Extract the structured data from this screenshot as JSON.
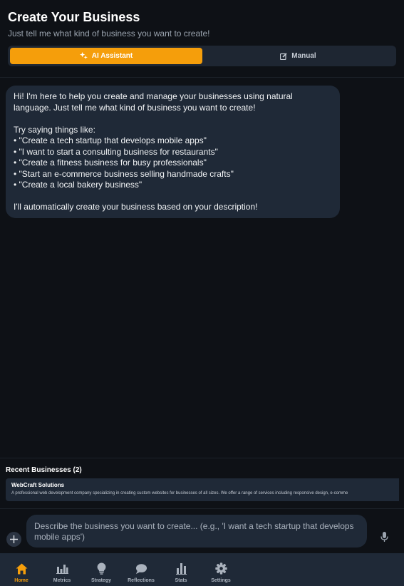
{
  "header": {
    "title": "Create Your Business",
    "subtitle": "Just tell me what kind of business you want to create!",
    "modes": [
      {
        "label": "AI Assistant",
        "icon": "sparkle-icon",
        "active": true
      },
      {
        "label": "Manual",
        "icon": "edit-icon",
        "active": false
      }
    ]
  },
  "chat": {
    "messages": [
      {
        "role": "assistant",
        "lines": [
          "Hi! I'm here to help you create and manage your businesses using natural language. Just tell me what kind of business you want to create!",
          "",
          "Try saying things like:",
          "• \"Create a tech startup that develops mobile apps\"",
          "• \"I want to start a consulting business for restaurants\"",
          "• \"Create a fitness business for busy professionals\"",
          "• \"Start an e-commerce business selling handmade crafts\"",
          "• \"Create a local bakery business\"",
          "",
          "I'll automatically create your business based on your description!"
        ]
      }
    ]
  },
  "recent": {
    "title": "Recent Businesses (2)",
    "items": [
      {
        "name": "WebCraft Solutions",
        "description": "A professional web development company specializing in creating custom websites for businesses of all sizes. We offer a range of services including responsive design, e-comme"
      }
    ]
  },
  "composer": {
    "placeholder": "Describe the business you want to create... (e.g., 'I want a tech startup that develops mobile apps')",
    "add_icon": "plus-icon",
    "mic_icon": "microphone-icon"
  },
  "nav": {
    "items": [
      {
        "label": "Home",
        "icon": "home-icon",
        "active": true
      },
      {
        "label": "Metrics",
        "icon": "bar-chart-icon",
        "active": false
      },
      {
        "label": "Strategy",
        "icon": "lightbulb-icon",
        "active": false
      },
      {
        "label": "Reflections",
        "icon": "chat-bubbles-icon",
        "active": false
      },
      {
        "label": "Stats",
        "icon": "stats-icon",
        "active": false
      },
      {
        "label": "Settings",
        "icon": "gear-icon",
        "active": false
      }
    ]
  },
  "colors": {
    "accent": "#f59e0b",
    "background": "#0e1116",
    "surface": "#1f2937"
  }
}
